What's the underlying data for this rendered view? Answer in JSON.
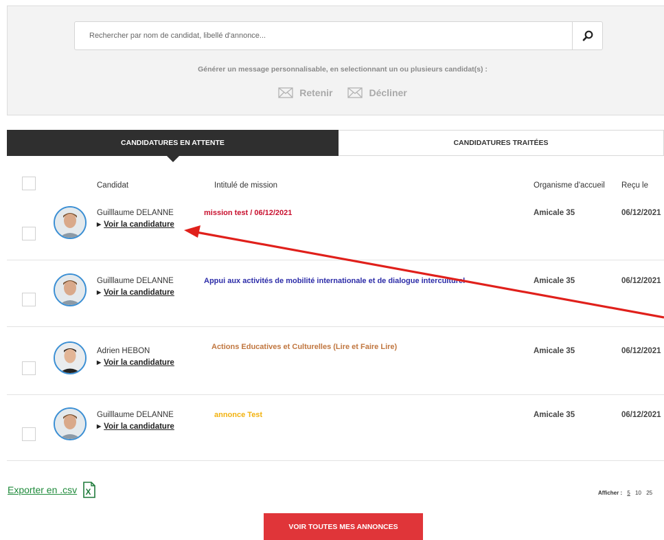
{
  "search": {
    "placeholder": "Rechercher par nom de candidat, libellé d'annonce...",
    "icon": "search-icon"
  },
  "message": {
    "label": "Générer un message personnalisable, en selectionnant un ou plusieurs candidat(s) :",
    "retain_label": "Retenir",
    "decline_label": "Décliner",
    "icon": "envelope-icon",
    "color": "#a9a9a9"
  },
  "tabs": [
    {
      "label": "CANDIDATURES EN ATTENTE",
      "active": true
    },
    {
      "label": "CANDIDATURES TRAITÉES",
      "active": false
    }
  ],
  "columns": {
    "candidate": "Candidat",
    "mission": "Intitulé de mission",
    "organisation": "Organisme d'accueil",
    "received": "Reçu le"
  },
  "rows": [
    {
      "name": "Guilllaume DELANNE",
      "link": "Voir la candidature",
      "mission": "mission test / 06/12/2021",
      "mission_color": "#c8102e",
      "organisation": "Amicale 35",
      "received": "06/12/2021"
    },
    {
      "name": "Guilllaume DELANNE",
      "link": "Voir la candidature",
      "mission": "Appui aux activités de mobilité internationale et de dialogue interculturel",
      "mission_color": "#2c2ca8",
      "organisation": "Amicale 35",
      "received": "06/12/2021"
    },
    {
      "name": "Adrien HEBON",
      "link": "Voir la candidature",
      "mission": "Actions Educatives et Culturelles (Lire et Faire Lire)",
      "mission_color": "#c0763f",
      "organisation": "Amicale 35",
      "received": "06/12/2021"
    },
    {
      "name": "Guilllaume DELANNE",
      "link": "Voir la candidature",
      "mission": "annonce Test",
      "mission_color": "#f2b20f",
      "organisation": "Amicale 35",
      "received": "06/12/2021"
    }
  ],
  "footer": {
    "export_label": "Exporter en .csv",
    "export_icon": "excel-icon",
    "show_label": "Afficher :",
    "page_sizes": [
      "5",
      "10",
      "25"
    ],
    "selected_page_size": "5",
    "cta_label": "VOIR TOUTES MES ANNONCES"
  },
  "colors": {
    "accent": "#e03539",
    "tab_active_bg": "#2f2f2f",
    "avatar_border": "#3b8fd4",
    "export_green": "#1e8a3a",
    "annotation_arrow": "#e0201b"
  }
}
